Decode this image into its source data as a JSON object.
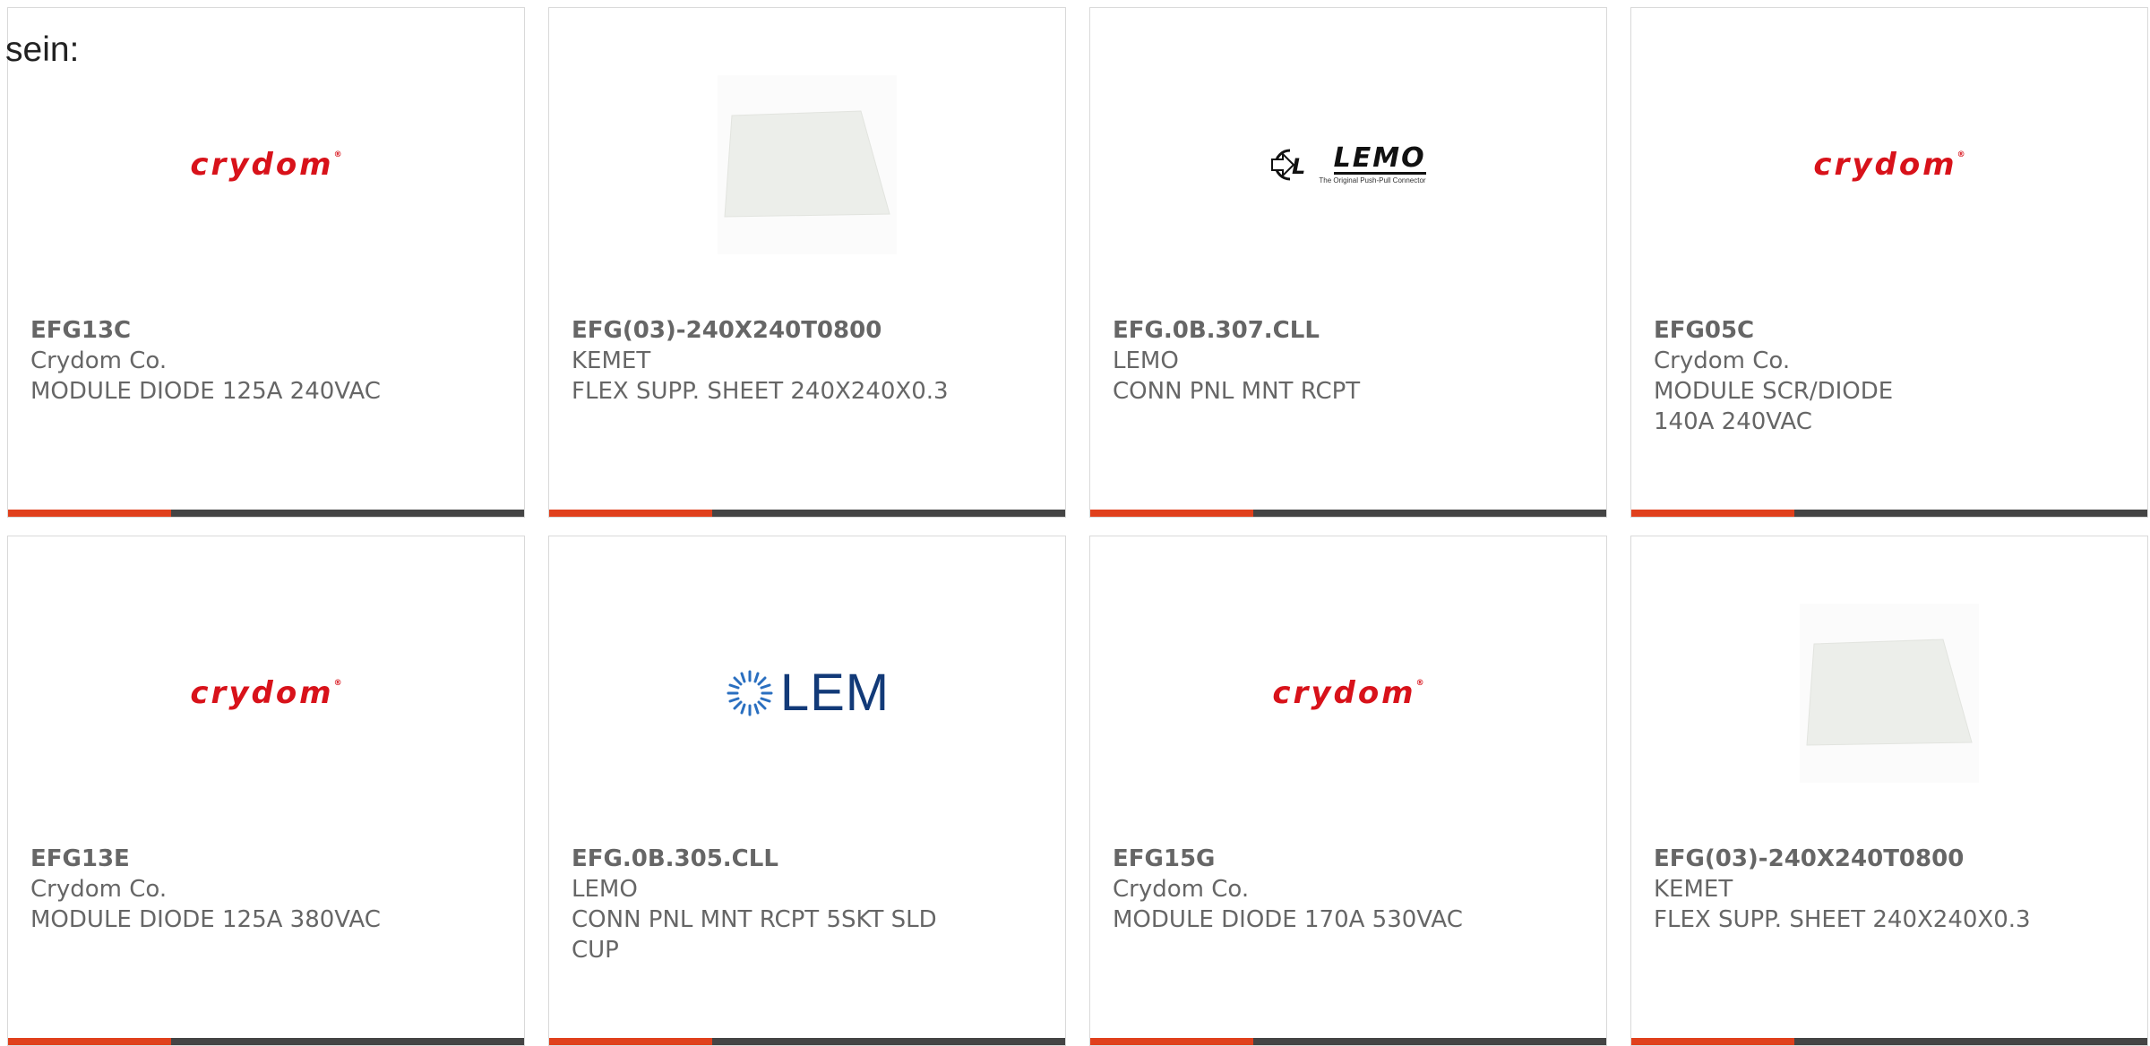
{
  "page": {
    "lead_text": "sein:"
  },
  "colors": {
    "accent": "#e0401c",
    "bar": "#444444",
    "crydom_red": "#d8121a",
    "lem_blue": "#123a78",
    "text": "#666666"
  },
  "products": [
    {
      "part_number": "EFG13C",
      "manufacturer": "Crydom Co.",
      "description": "MODULE DIODE 125A 240VAC",
      "logo": {
        "type": "crydom",
        "text": "crydom",
        "mark": "®"
      }
    },
    {
      "part_number": "EFG(03)-240X240T0800",
      "manufacturer": "KEMET",
      "description": "FLEX SUPP. SHEET 240X240X0.3",
      "logo": {
        "type": "sheet-image"
      }
    },
    {
      "part_number": "EFG.0B.307.CLL",
      "manufacturer": "LEMO",
      "description": "CONN PNL MNT RCPT",
      "logo": {
        "type": "lemo",
        "text": "LEMO",
        "tagline": "The Original Push-Pull Connector"
      }
    },
    {
      "part_number": "EFG05C",
      "manufacturer": "Crydom Co.",
      "description": "MODULE SCR/DIODE 140A 240VAC",
      "logo": {
        "type": "crydom",
        "text": "crydom",
        "mark": "®"
      }
    },
    {
      "part_number": "EFG13E",
      "manufacturer": "Crydom Co.",
      "description": "MODULE DIODE 125A 380VAC",
      "logo": {
        "type": "crydom",
        "text": "crydom",
        "mark": "®"
      }
    },
    {
      "part_number": "EFG.0B.305.CLL",
      "manufacturer": "LEMO",
      "description": "CONN PNL MNT RCPT 5SKT SLD CUP",
      "logo": {
        "type": "lem",
        "text": "LEM"
      }
    },
    {
      "part_number": "EFG15G",
      "manufacturer": "Crydom Co.",
      "description": "MODULE DIODE 170A 530VAC",
      "logo": {
        "type": "crydom",
        "text": "crydom",
        "mark": "®"
      }
    },
    {
      "part_number": "EFG(03)-240X240T0800",
      "manufacturer": "KEMET",
      "description": "FLEX SUPP. SHEET 240X240X0.3",
      "logo": {
        "type": "sheet-image"
      }
    }
  ]
}
